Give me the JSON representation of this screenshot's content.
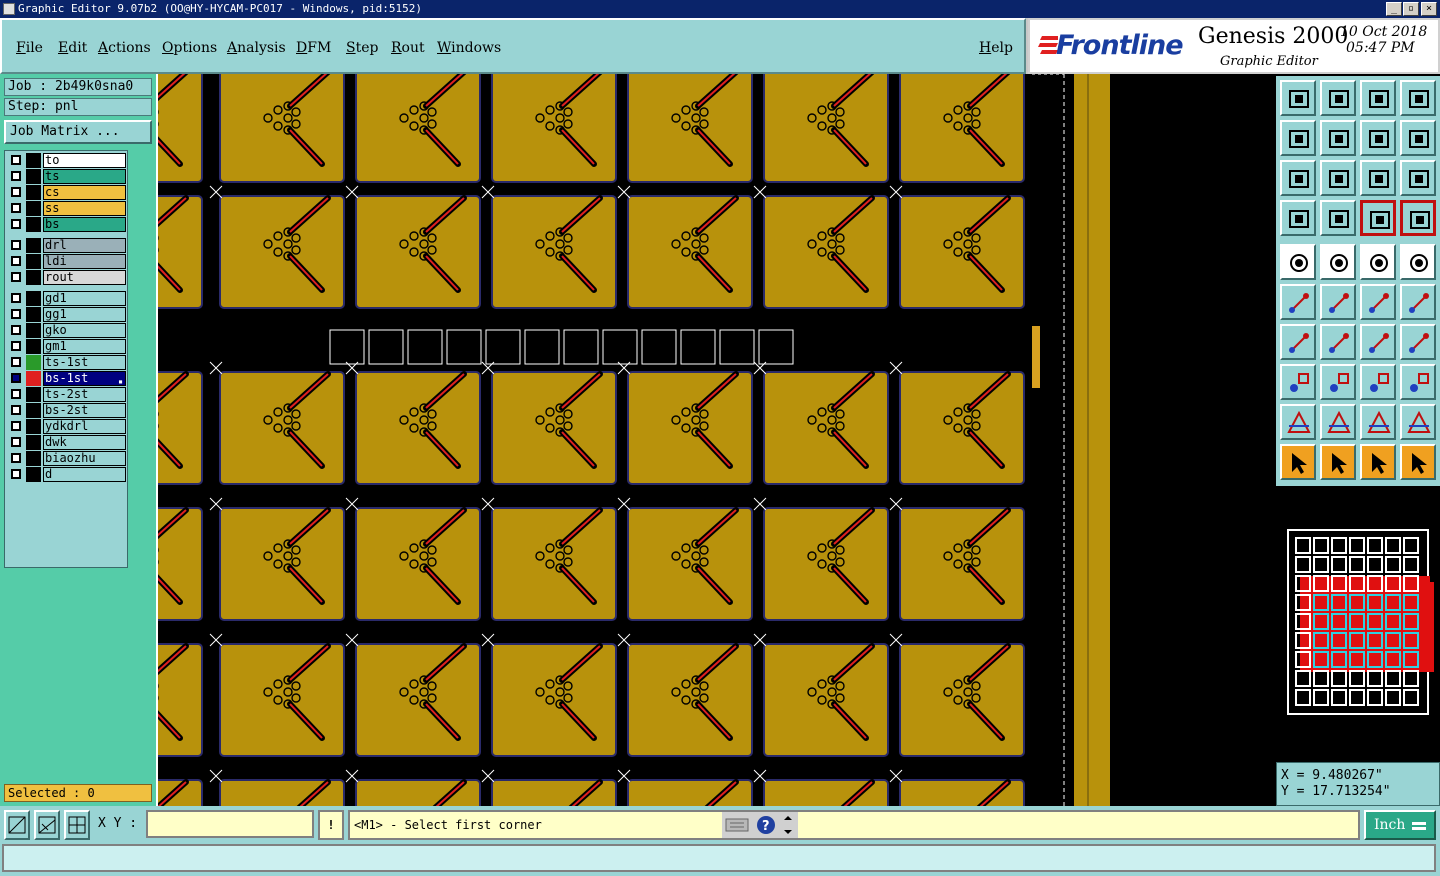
{
  "window": {
    "title": "Graphic Editor 9.07b2 (OO@HY-HYCAM-PC017 - Windows, pid:5152)"
  },
  "menu": [
    {
      "label": "File"
    },
    {
      "label": "Edit"
    },
    {
      "label": "Actions"
    },
    {
      "label": "Options"
    },
    {
      "label": "Analysis"
    },
    {
      "label": "DFM"
    },
    {
      "label": "Step"
    },
    {
      "label": "Rout"
    },
    {
      "label": "Windows"
    },
    {
      "label": "Help"
    }
  ],
  "brand": {
    "logo": "Frontline",
    "product": "Genesis 2000",
    "subtitle": "Graphic Editor",
    "date": "10 Oct 2018",
    "time": "05:47 PM"
  },
  "job": {
    "job_label": "Job : 2b49k0sna0",
    "step_label": "Step: pnl",
    "matrix_button": "Job Matrix ..."
  },
  "layers": [
    {
      "name": "to",
      "bg": "#ffffff",
      "color": "#000000"
    },
    {
      "name": "ts",
      "bg": "#2aa888",
      "color": "#000000"
    },
    {
      "name": "cs",
      "bg": "#f0c040",
      "color": "#000000"
    },
    {
      "name": "ss",
      "bg": "#f0c040",
      "color": "#000000"
    },
    {
      "name": "bs",
      "bg": "#2aa888",
      "color": "#000000"
    },
    {
      "name": "drl",
      "bg": "#9ab0b8",
      "color": "#000000"
    },
    {
      "name": "ldi",
      "bg": "#9ab0b8",
      "color": "#000000"
    },
    {
      "name": "rout",
      "bg": "#d8d8d8",
      "color": "#000000"
    },
    {
      "name": "gd1",
      "bg": "#99d4d4",
      "color": "#000000"
    },
    {
      "name": "gg1",
      "bg": "#99d4d4",
      "color": "#000000"
    },
    {
      "name": "gko",
      "bg": "#99d4d4",
      "color": "#000000"
    },
    {
      "name": "gm1",
      "bg": "#99d4d4",
      "color": "#000000"
    },
    {
      "name": "ts-1st",
      "bg": "#99d4d4",
      "color": "#2a9a2a"
    },
    {
      "name": "bs-1st",
      "bg": "#000080",
      "color": "#e02020",
      "text_color": "#ffffff",
      "active": true
    },
    {
      "name": "ts-2st",
      "bg": "#99d4d4",
      "color": "#000000"
    },
    {
      "name": "bs-2st",
      "bg": "#99d4d4",
      "color": "#000000"
    },
    {
      "name": "ydkdrl",
      "bg": "#99d4d4",
      "color": "#000000"
    },
    {
      "name": "dwk",
      "bg": "#99d4d4",
      "color": "#000000"
    },
    {
      "name": "biaozhu",
      "bg": "#99d4d4",
      "color": "#000000"
    },
    {
      "name": "d",
      "bg": "#99d4d4",
      "color": "#000000"
    }
  ],
  "selected": "Selected : 0",
  "coords": {
    "x": "X = 9.480267\"",
    "y": "Y = 17.713254\""
  },
  "bottom": {
    "xy_label": "X Y :",
    "xy_value": "",
    "prompt": "<M1> - Select first corner",
    "units": "Inch"
  },
  "colors": {
    "board": "#b8920c",
    "trace": "#e02020",
    "outline": "#1a1a5a",
    "accent": "#2aa888"
  }
}
